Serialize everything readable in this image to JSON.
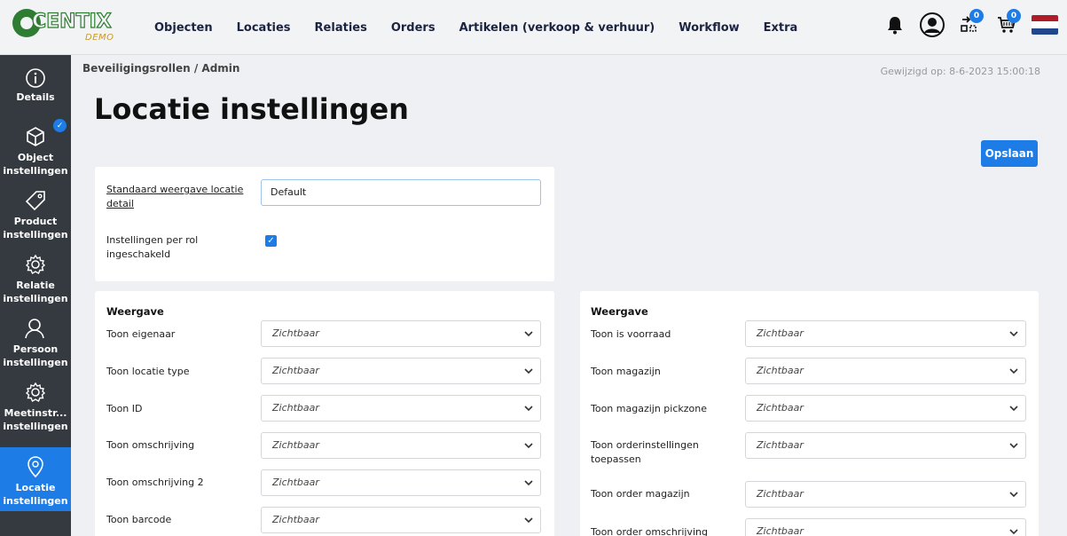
{
  "logo": {
    "text": "CENTIX",
    "demo": "DEMO"
  },
  "nav": [
    "Objecten",
    "Locaties",
    "Relaties",
    "Orders",
    "Artikelen (verkoop & verhuur)",
    "Workflow",
    "Extra"
  ],
  "header_icons": {
    "badge1": "0",
    "badge2": "0"
  },
  "sidebar": [
    {
      "label": "Details",
      "icon": "info-icon"
    },
    {
      "label": "Object instellingen",
      "icon": "cube-icon"
    },
    {
      "label": "Product instellingen",
      "icon": "tag-icon"
    },
    {
      "label": "Relatie instellingen",
      "icon": "gear-icon"
    },
    {
      "label": "Persoon instellingen",
      "icon": "person-icon"
    },
    {
      "label": "Meetinstr... instellingen",
      "icon": "gear-icon"
    },
    {
      "label": "Locatie instellingen",
      "icon": "location-icon"
    }
  ],
  "breadcrumb": {
    "parent": "Beveiligingsrollen",
    "sep": "/",
    "current": "Admin"
  },
  "modified": "Gewijzigd op: 8-6-2023 15:00:18",
  "title": "Locatie instellingen",
  "save_label": "Opslaan",
  "top_card": {
    "default_view_label": "Standaard weergave locatie detail",
    "default_view_value": "Default",
    "per_role_label": "Instellingen per rol ingeschakeld"
  },
  "left_card": {
    "title": "Weergave",
    "rows": [
      {
        "label": "Toon eigenaar",
        "value": "Zichtbaar"
      },
      {
        "label": "Toon locatie type",
        "value": "Zichtbaar"
      },
      {
        "label": "Toon ID",
        "value": "Zichtbaar"
      },
      {
        "label": "Toon omschrijving",
        "value": "Zichtbaar"
      },
      {
        "label": "Toon omschrijving 2",
        "value": "Zichtbaar"
      },
      {
        "label": "Toon barcode",
        "value": "Zichtbaar"
      }
    ]
  },
  "right_card": {
    "title": "Weergave",
    "rows": [
      {
        "label": "Toon is voorraad",
        "value": "Zichtbaar"
      },
      {
        "label": "Toon magazijn",
        "value": "Zichtbaar"
      },
      {
        "label": "Toon magazijn pickzone",
        "value": "Zichtbaar"
      },
      {
        "label": "Toon orderinstellingen toepassen",
        "value": "Zichtbaar"
      },
      {
        "label": "Toon order magazijn",
        "value": "Zichtbaar"
      },
      {
        "label": "Toon order omschrijving",
        "value": "Zichtbaar"
      }
    ]
  },
  "colors": {
    "accent": "#1e7ce6",
    "sidebar": "#343a40",
    "brand_green": "#2e7d32"
  }
}
